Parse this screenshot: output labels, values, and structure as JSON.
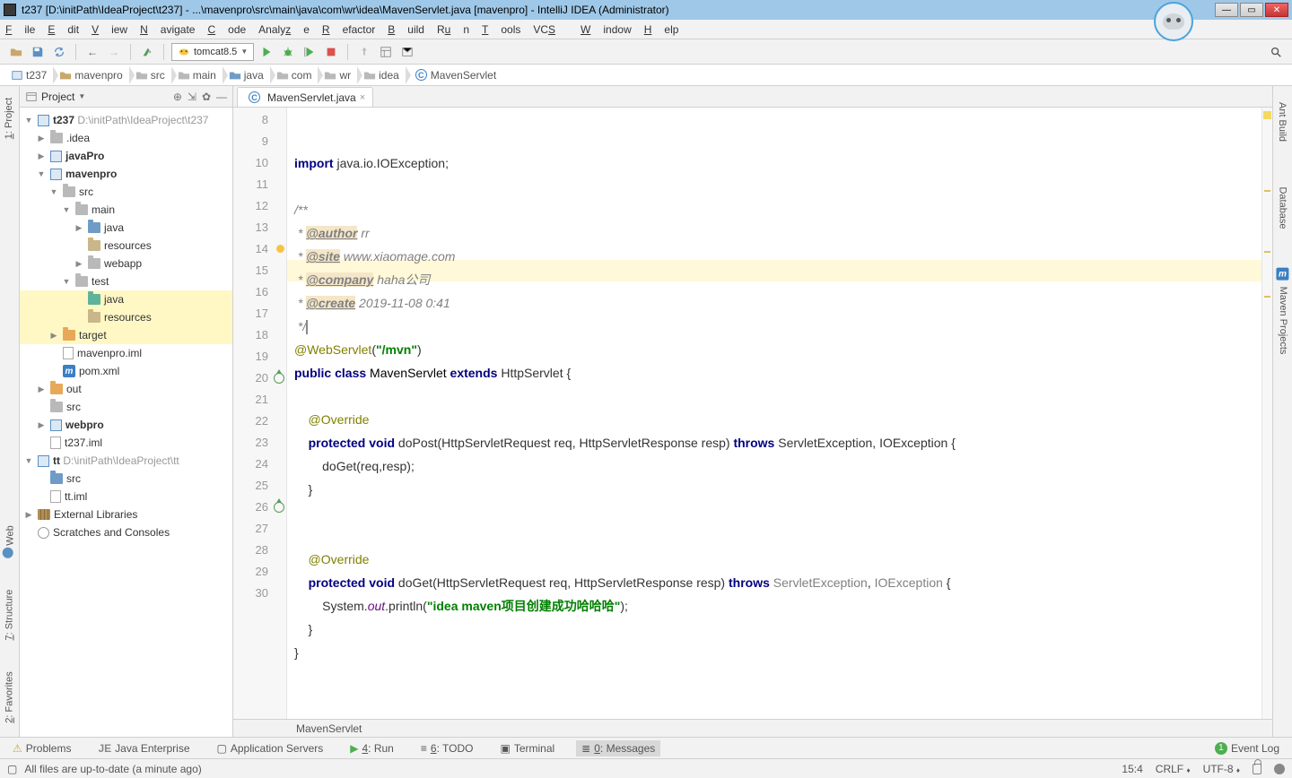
{
  "title": "t237 [D:\\initPath\\IdeaProject\\t237] - ...\\mavenpro\\src\\main\\java\\com\\wr\\idea\\MavenServlet.java [mavenpro] - IntelliJ IDEA (Administrator)",
  "menu": [
    "File",
    "Edit",
    "View",
    "Navigate",
    "Code",
    "Analyze",
    "Refactor",
    "Build",
    "Run",
    "Tools",
    "VCS",
    "Window",
    "Help"
  ],
  "menu_underline_idx": [
    0,
    0,
    0,
    0,
    0,
    -1,
    -1,
    0,
    -1,
    0,
    -1,
    0,
    0
  ],
  "run_config": "tomcat8.5",
  "breadcrumbs": [
    "t237",
    "mavenpro",
    "src",
    "main",
    "java",
    "com",
    "wr",
    "idea",
    "MavenServlet"
  ],
  "sidebar": {
    "title": "Project"
  },
  "tree": {
    "root_name": "t237",
    "root_path": "D:\\initPath\\IdeaProject\\t237",
    "idea": ".idea",
    "javaPro": "javaPro",
    "mavenpro": "mavenpro",
    "src": "src",
    "main": "main",
    "java": "java",
    "resources": "resources",
    "webapp": "webapp",
    "test": "test",
    "java2": "java",
    "resources2": "resources",
    "target": "target",
    "iml": "mavenpro.iml",
    "pom": "pom.xml",
    "out": "out",
    "src2": "src",
    "webpro": "webpro",
    "t237iml": "t237.iml",
    "tt": "tt",
    "tt_path": "D:\\initPath\\IdeaProject\\tt",
    "src3": "src",
    "ttiml": "tt.iml",
    "extlib": "External Libraries",
    "scratch": "Scratches and Consoles"
  },
  "tab": {
    "name": "MavenServlet.java"
  },
  "lines": {
    "start": 8,
    "l8_a": "import",
    "l8_b": " java.io.IOException;",
    "l10": "/**",
    "l11_a": " * ",
    "l11_tag": "@author",
    "l11_b": " rr",
    "l12_a": " * ",
    "l12_tag": "@site",
    "l12_b": " www.xiaomage.com",
    "l13_a": " * ",
    "l13_tag": "@company",
    "l13_b": " haha公司",
    "l14_a": " * ",
    "l14_tag": "@create",
    "l14_b": " 2019-11-08 0:41",
    "l15": " */",
    "l16_a": "@WebServlet",
    "l16_b": "(",
    "l16_c": "\"/mvn\"",
    "l16_d": ")",
    "l17_a": "public class ",
    "l17_b": "MavenServlet ",
    "l17_c": "extends ",
    "l17_d": "HttpServlet {",
    "l19": "    @Override",
    "l20_a": "    ",
    "l20_b": "protected void ",
    "l20_c": "doPost",
    "l20_d": "(HttpServletRequest req, HttpServletResponse resp) ",
    "l20_e": "throws ",
    "l20_f": "ServletException, IOException {",
    "l21": "        doGet(req,resp);",
    "l22": "    }",
    "l25": "    @Override",
    "l26_a": "    ",
    "l26_b": "protected void ",
    "l26_c": "doGet",
    "l26_d": "(HttpServletRequest req, HttpServletResponse resp) ",
    "l26_e": "throws ",
    "l26_f": "ServletException",
    "l26_g": ", ",
    "l26_h": "IOException",
    " l26_i": " {",
    "l27_a": "        System.",
    "l27_b": "out",
    "l27_c": ".println(",
    "l27_d": "\"idea maven项目创建成功哈哈哈\"",
    "l27_e": ");",
    "l28": "    }",
    "l29": "}"
  },
  "editor_crumb": "MavenServlet",
  "bottom": {
    "problems": "Problems",
    "je": "Java Enterprise",
    "as": "Application Servers",
    "run": "4: Run",
    "todo": "6: TODO",
    "term": "Terminal",
    "msg": "0: Messages",
    "elog": "Event Log"
  },
  "status": {
    "msg": "All files are up-to-date (a minute ago)",
    "pos": "15:4",
    "crlf": "CRLF",
    "enc": "UTF-8"
  },
  "left_tabs": [
    "1: Project",
    "7: Structure",
    "2: Favorites",
    "Web"
  ],
  "right_tabs": [
    "Ant Build",
    "Database",
    "Maven Projects"
  ]
}
